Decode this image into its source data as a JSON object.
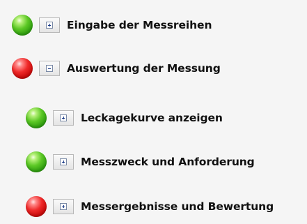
{
  "tree": {
    "items": [
      {
        "label": "Eingabe der Messreihen",
        "status": "green",
        "status_color": "#3cb516",
        "toggle_icon": "plus-icon",
        "expanded": false
      },
      {
        "label": "Auswertung der Messung",
        "status": "red",
        "status_color": "#e01b1b",
        "toggle_icon": "minus-icon",
        "expanded": true,
        "children": [
          {
            "label": "Leckagekurve anzeigen",
            "status": "green",
            "status_color": "#3cb516",
            "toggle_icon": "plus-icon",
            "expanded": false
          },
          {
            "label": "Messzweck und Anforderung",
            "status": "green",
            "status_color": "#3cb516",
            "toggle_icon": "plus-icon",
            "expanded": false
          },
          {
            "label": "Messergebnisse und Bewertung",
            "status": "red",
            "status_color": "#e01b1b",
            "toggle_icon": "plus-icon",
            "expanded": false
          }
        ]
      }
    ]
  }
}
